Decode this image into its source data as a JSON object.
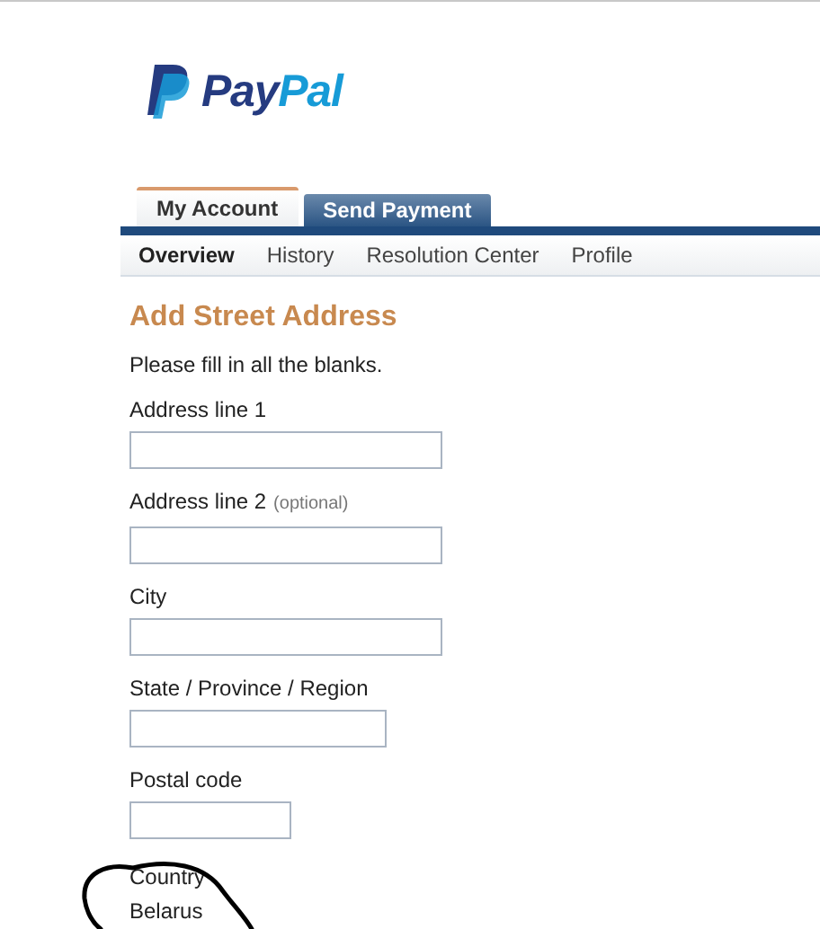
{
  "logo": {
    "parts": [
      "Pay",
      "Pal"
    ]
  },
  "tabs": [
    {
      "label": "My Account",
      "selected": true
    },
    {
      "label": "Send Payment",
      "selected": false
    }
  ],
  "subnav": [
    {
      "label": "Overview",
      "selected": true
    },
    {
      "label": "History",
      "selected": false
    },
    {
      "label": "Resolution Center",
      "selected": false
    },
    {
      "label": "Profile",
      "selected": false
    }
  ],
  "heading": "Add Street Address",
  "instructions": "Please fill in all the blanks.",
  "fields": [
    {
      "label": "Address line 1"
    },
    {
      "label": "Address line 2",
      "note": "(optional)"
    },
    {
      "label": "City"
    },
    {
      "label": "State / Province / Region"
    },
    {
      "label": "Postal code"
    }
  ],
  "country": {
    "label": "Country",
    "value": "Belarus"
  }
}
